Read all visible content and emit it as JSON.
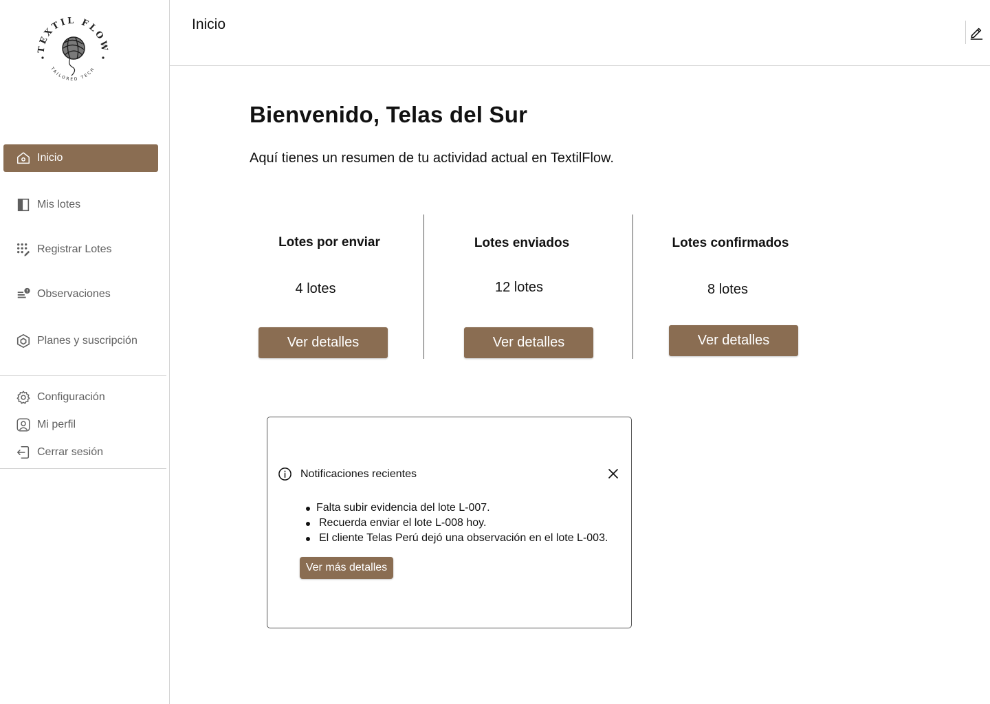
{
  "brand": {
    "logo_text_top": "TEXTIL FLOW",
    "logo_text_bottom": "TAILORED TECH",
    "logo_icon": "yarn-ball-icon"
  },
  "sidebar": {
    "items": [
      {
        "label": "Inicio",
        "icon": "home-icon",
        "active": true
      },
      {
        "label": "Mis lotes",
        "icon": "panel-icon",
        "active": false
      },
      {
        "label": "Registrar Lotes",
        "icon": "grid-dots-icon",
        "active": false
      },
      {
        "label": "Observaciones",
        "icon": "list-alert-icon",
        "active": false
      },
      {
        "label": "Planes y suscripción",
        "icon": "package-icon",
        "active": false
      }
    ],
    "footer_items": [
      {
        "label": "Configuración",
        "icon": "gear-icon"
      },
      {
        "label": "Mi perfil",
        "icon": "user-square-icon"
      },
      {
        "label": "Cerrar sesión",
        "icon": "logout-icon"
      }
    ]
  },
  "header": {
    "title": "Inicio",
    "edit_icon": "pencil-icon"
  },
  "main": {
    "welcome_title": "Bienvenido, Telas del Sur",
    "welcome_subtitle": "Aquí tienes un resumen de tu actividad actual en TextilFlow.",
    "stats": [
      {
        "title": "Lotes por enviar",
        "value": "4 lotes",
        "button": "Ver detalles"
      },
      {
        "title": "Lotes enviados",
        "value": "12 lotes",
        "button": "Ver detalles"
      },
      {
        "title": "Lotes confirmados",
        "value": "8 lotes",
        "button": "Ver detalles"
      }
    ]
  },
  "notifications": {
    "title": "Notificaciones recientes",
    "items": [
      "Falta subir evidencia del lote L-007.",
      "Recuerda enviar el lote L-008 hoy.",
      "El cliente Telas Perú dejó una observación en el lote L-003."
    ],
    "button": "Ver más detalles"
  },
  "colors": {
    "accent": "#8a6d52",
    "text": "#111111",
    "muted_text": "#5f5f5f",
    "divider": "#d4d4d4"
  }
}
